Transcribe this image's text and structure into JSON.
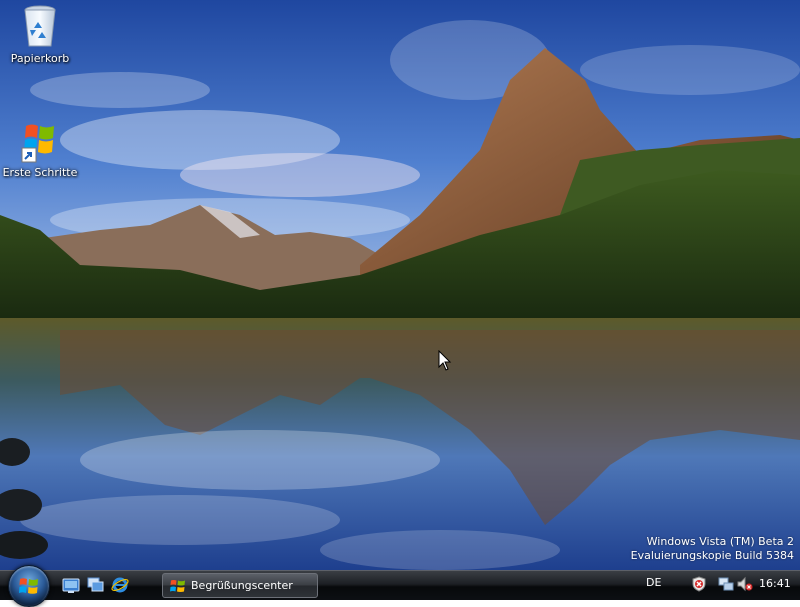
{
  "desktop": {
    "icons": [
      {
        "label": "Papierkorb",
        "icon": "recycle-bin-icon"
      },
      {
        "label": "Erste Schritte",
        "icon": "windows-flag-shortcut-icon"
      }
    ],
    "watermark": {
      "line1": "Windows Vista (TM) Beta 2",
      "line2": "Evaluierungskopie Build 5384"
    }
  },
  "taskbar": {
    "quick_launch": [
      "show-desktop-icon",
      "switch-windows-icon",
      "internet-explorer-icon"
    ],
    "task_button_label": "Begrüßungscenter",
    "language": "DE",
    "tray_icons": [
      "security-shield-icon",
      "network-icon",
      "volume-muted-icon"
    ],
    "clock": "16:41"
  },
  "colors": {
    "taskbar_dark": "#0c0f13",
    "taskbar_text": "#ffffff",
    "start_orb": "#2c5c9a"
  }
}
